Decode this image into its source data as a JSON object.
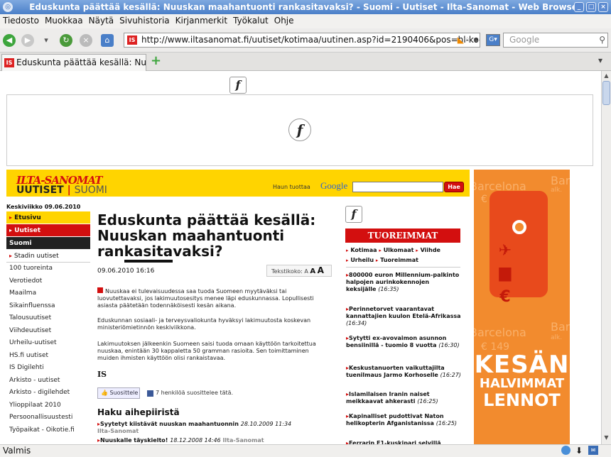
{
  "window": {
    "title": "Eduskunta päättää kesällä: Nuuskan maahantuonti rankasitavaksi? - Suomi - Uutiset - Ilta-Sanomat - Web Browser"
  },
  "menu": [
    "Tiedosto",
    "Muokkaa",
    "Näytä",
    "Sivuhistoria",
    "Kirjanmerkit",
    "Työkalut",
    "Ohje"
  ],
  "nav": {
    "url": "http://www.iltasanomat.fi/uutiset/kotimaa/uutinen.asp?id=2190406&pos=hl-ko-",
    "search_placeholder": "Google",
    "favicon": "IS"
  },
  "tab": {
    "title": "Eduskunta päättää kesällä: Nuu...",
    "new_tab_icon": "plus-icon"
  },
  "status": "Valmis",
  "site": {
    "logo_top": "ILTA-SANOMAT",
    "logo_uutiset": "UUTISET",
    "logo_sep": "|",
    "logo_suomi": "SUOMI",
    "search_by": "Haun tuottaa",
    "google": "Google",
    "search_button": "Hae"
  },
  "leftnav": {
    "date": "Keskiviikko 09.06.2010",
    "items": [
      {
        "label": "Etusivu",
        "style": "y",
        "tri": "▸"
      },
      {
        "label": "Uutiset",
        "style": "r",
        "tri": "▸"
      },
      {
        "label": "Suomi",
        "style": "k",
        "tri": ""
      },
      {
        "label": "Stadin uutiset",
        "style": "s",
        "tri": "▸"
      },
      {
        "label": "100 tuoreinta",
        "style": "g",
        "tri": ""
      },
      {
        "label": "Verotiedot",
        "style": "g",
        "tri": ""
      },
      {
        "label": "Maailma",
        "style": "g",
        "tri": ""
      },
      {
        "label": "Sikainfluenssa",
        "style": "g",
        "tri": ""
      },
      {
        "label": "Talousuutiset",
        "style": "g",
        "tri": ""
      },
      {
        "label": "Viihdeuutiset",
        "style": "g",
        "tri": ""
      },
      {
        "label": "Urheilu-uutiset",
        "style": "g",
        "tri": ""
      },
      {
        "label": "HS.fi uutiset",
        "style": "g",
        "tri": ""
      },
      {
        "label": "IS Digilehti",
        "style": "g",
        "tri": ""
      },
      {
        "label": "Arkisto - uutiset",
        "style": "g",
        "tri": ""
      },
      {
        "label": "Arkisto - digilehdet",
        "style": "g",
        "tri": ""
      },
      {
        "label": "Ylioppilaat 2010",
        "style": "g",
        "tri": ""
      },
      {
        "label": "Persoonallisuustesti",
        "style": "g",
        "tri": ""
      },
      {
        "label": "Työpaikat - Oikotie.fi",
        "style": "g",
        "tri": ""
      }
    ]
  },
  "article": {
    "headline_1": "Eduskunta päättää kesällä:",
    "headline_2": "Nuuskan maahantuonti",
    "headline_3a": "ran",
    "headline_3b": "kasita",
    "headline_3c": "vaksi?",
    "datetime": "09.06.2010 16:16",
    "textsize_label": "Tekstikoko:",
    "textsize_a1": "A",
    "textsize_a2": "A",
    "textsize_a3": "A",
    "p1": "Nuuskaa ei tulevaisuudessa saa tuoda Suomeen myytäväksi tai luovutettavaksi, jos lakimuutosesitys menee läpi eduskunnassa. Lopullisesti asiasta päätetään todennäköisesti kesän aikana.",
    "p2": "Eduskunnan sosiaali- ja terveysvaliokunta hyväksyi lakimuutosta koskevan ministeriömietinnön keskiviikkona.",
    "p3": "Lakimuutoksen jälkeenkin Suomeen saisi tuoda omaan käyttöön tarkoitettua nuuskaa, enintään 30 kappaletta 50 gramman rasioita. Sen toimittaminen muiden ihmisten käyttöön olisi rankaistavaa.",
    "author": "IS",
    "like_button": "Suosittele",
    "like_text": "7 henkilöä suosittelee tätä.",
    "related_title": "Haku aihepiiristä",
    "related": [
      {
        "title": "Syytetyt kiistävät nuuskan maahantuonnin",
        "date": "28.10.2009 11:34",
        "src": "Ilta-Sanomat"
      },
      {
        "title": "Nuuskalle täyskielto!",
        "date": "18.12.2008 14:46",
        "src": "Ilta-Sanomat"
      }
    ]
  },
  "latest": {
    "title": "TUOREIMMAT UUTISET",
    "cats_line1": [
      "Kotimaa",
      "Ulkomaat",
      "Viihde"
    ],
    "cats_line2": [
      "Urheilu",
      "Tuoreimmat"
    ],
    "items": [
      {
        "title": "800000 euron Millennium-palkinto halpojen aurinkokennojen keksijälle",
        "time": "(16:35)"
      },
      {
        "title": "Perinnetorvet vaarantavat kannattajien kuulon Etelä-Afrikassa",
        "time": "(16:34)"
      },
      {
        "title": "Sytytti ex-avovaimon asunnon bensiinillä - tuomio 8 vuotta",
        "time": "(16:30)"
      },
      {
        "title": "Keskustanuorten vaikuttajilta tuenilmaus Jarmo Korhoselle",
        "time": "(16:27)"
      },
      {
        "title": "Islamilaisen Iranin naiset meikkaavat ahkerasti",
        "time": "(16:25)"
      },
      {
        "title": "Kapinalliset pudottivat Naton helikopterin Afganistanissa",
        "time": "(16:25)"
      },
      {
        "title": "Ferrarin F1-kuskipari selvillä",
        "time": ""
      }
    ]
  },
  "ad": {
    "bg1": "Barcelona",
    "bg2": "Bar",
    "bg3": "€ 149",
    "bg4": "alk.",
    "line1": "KESÄN",
    "line2": "HALVIMMAT",
    "line3": "LENNOT",
    "plane": "✈",
    "bag": "▆",
    "euro": "€"
  },
  "colors": {
    "brand_red": "#d30f0f",
    "brand_yellow": "#ffd400",
    "ad_orange": "#f28b2e"
  }
}
